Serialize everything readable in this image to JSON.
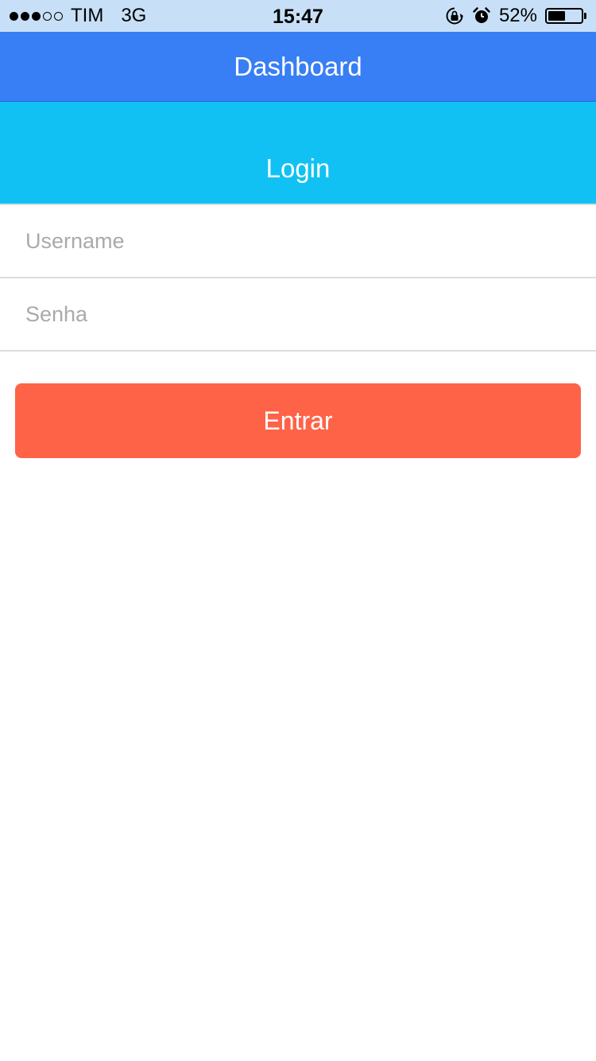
{
  "status_bar": {
    "signal_dots_filled": 3,
    "signal_dots_total": 5,
    "carrier": "TIM",
    "network": "3G",
    "time": "15:47",
    "icons": [
      "rotation-lock-icon",
      "alarm-icon"
    ],
    "battery_percent_label": "52%",
    "battery_level": 0.52
  },
  "nav": {
    "title": "Dashboard",
    "color": "#387ef5"
  },
  "login_header": {
    "title": "Login",
    "color": "#11c1f3"
  },
  "form": {
    "username_placeholder": "Username",
    "username_value": "",
    "password_placeholder": "Senha",
    "password_value": ""
  },
  "submit": {
    "label": "Entrar",
    "color": "#ff6347"
  }
}
